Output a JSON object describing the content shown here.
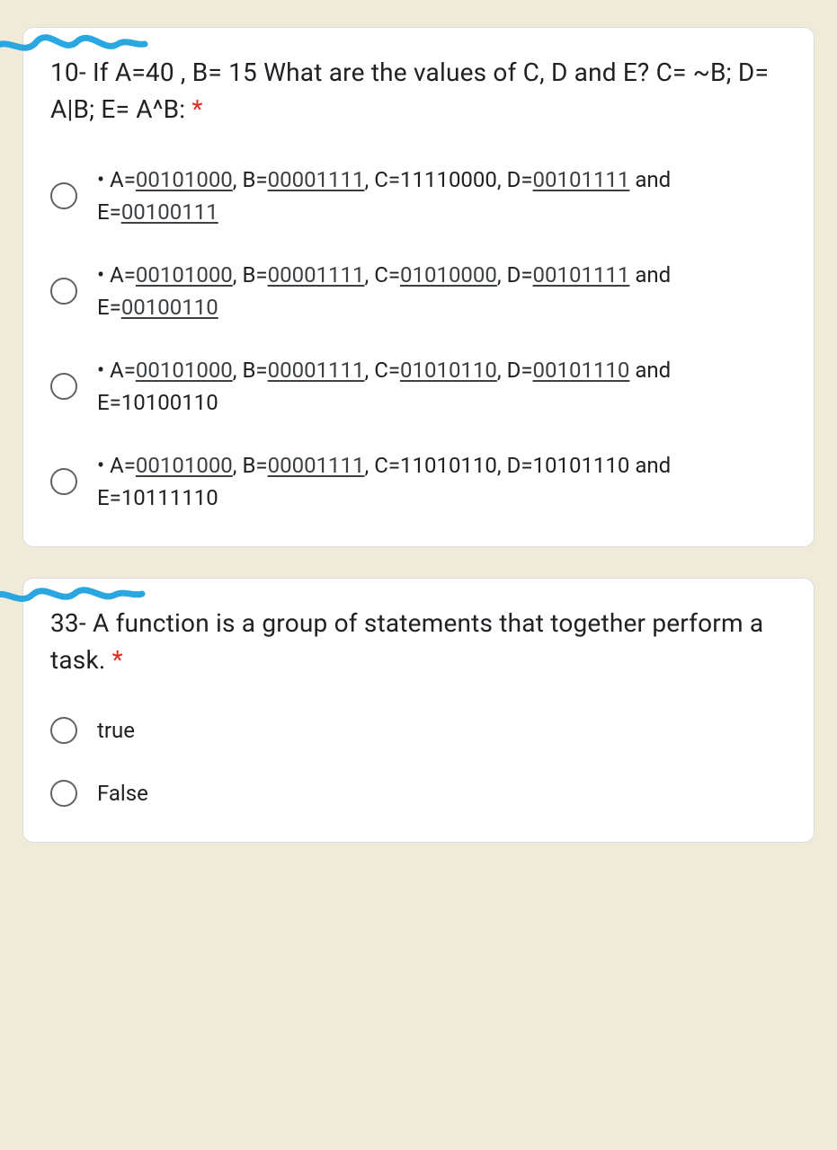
{
  "questions": [
    {
      "prompt_prefix": "10- If A=40 , B= 15 What are the values of C, D and E? C= ~B; D= A|B; E= A^B: ",
      "options": [
        {
          "segments": [
            {
              "t": "• A=",
              "u": false
            },
            {
              "t": "00101000",
              "u": true
            },
            {
              "t": ", B=",
              "u": false
            },
            {
              "t": "00001111",
              "u": true
            },
            {
              "t": ", C=11110000, D=",
              "u": false
            },
            {
              "t": "00101111",
              "u": true
            },
            {
              "t": " and E=",
              "u": false
            },
            {
              "t": "00100111",
              "u": true
            }
          ]
        },
        {
          "segments": [
            {
              "t": "• A=",
              "u": false
            },
            {
              "t": "00101000",
              "u": true
            },
            {
              "t": ", B=",
              "u": false
            },
            {
              "t": "00001111",
              "u": true
            },
            {
              "t": ", C=",
              "u": false
            },
            {
              "t": "01010000",
              "u": true
            },
            {
              "t": ", D=",
              "u": false
            },
            {
              "t": "00101111",
              "u": true
            },
            {
              "t": " and E=",
              "u": false
            },
            {
              "t": "00100110",
              "u": true
            }
          ]
        },
        {
          "segments": [
            {
              "t": "• A=",
              "u": false
            },
            {
              "t": "00101000",
              "u": true
            },
            {
              "t": ", B=",
              "u": false
            },
            {
              "t": "00001111",
              "u": true
            },
            {
              "t": ", C=",
              "u": false
            },
            {
              "t": "01010110",
              "u": true
            },
            {
              "t": ", D=",
              "u": false
            },
            {
              "t": "00101110",
              "u": true
            },
            {
              "t": " and E=10100110",
              "u": false
            }
          ]
        },
        {
          "segments": [
            {
              "t": "• A=",
              "u": false
            },
            {
              "t": "00101000",
              "u": true
            },
            {
              "t": ", B=",
              "u": false
            },
            {
              "t": "00001111",
              "u": true
            },
            {
              "t": ", C=11010110, D=10101110 and E=10111110",
              "u": false
            }
          ]
        }
      ]
    },
    {
      "prompt_prefix": "33- A function is a group of statements that together perform a task. ",
      "options": [
        {
          "plain": "true"
        },
        {
          "plain": "False"
        }
      ]
    }
  ],
  "asterisk": "*"
}
